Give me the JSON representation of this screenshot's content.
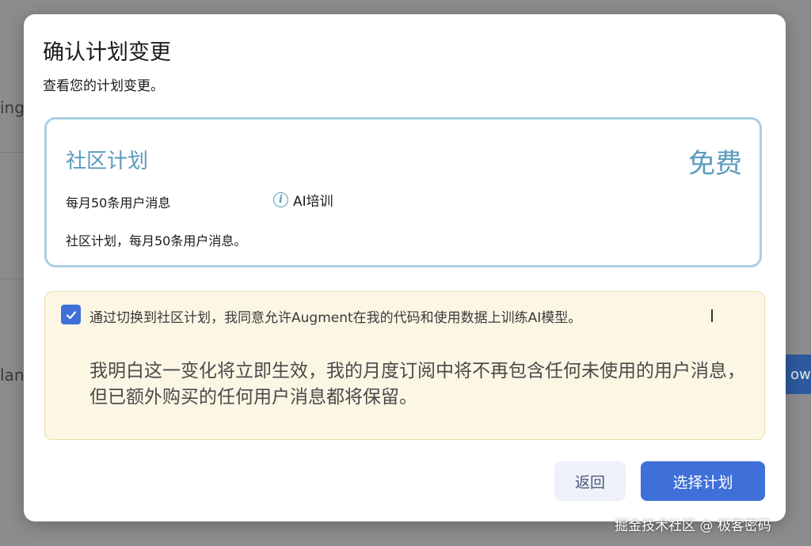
{
  "background": {
    "fragment_left_top": "ing",
    "fragment_left_mid": "lan",
    "fragment_right_btn": "ow"
  },
  "modal": {
    "title": "确认计划变更",
    "subtitle": "查看您的计划变更。"
  },
  "plan": {
    "name": "社区计划",
    "price": "免费",
    "feature": "每月50条用户消息",
    "info_icon": "info-icon",
    "info_label": "AI培训",
    "description": "社区计划，每月50条用户消息。"
  },
  "consent": {
    "checked": true,
    "checkbox_text": "通过切换到社区计划，我同意允许Augment在我的代码和使用数据上训练AI模型。",
    "notice": "我明白这一变化将立即生效，我的月度订阅中将不再包含任何未使用的用户消息，但已额外购买的任何用户消息都将保留。"
  },
  "actions": {
    "back_label": "返回",
    "select_label": "选择计划"
  },
  "watermark": "掘金技术社区 @ 极客密码",
  "colors": {
    "accent": "#3f6fd8",
    "plan_text": "#5a9bbd",
    "card_border": "#a9cfe0",
    "notice_bg": "#fcf7e4"
  }
}
